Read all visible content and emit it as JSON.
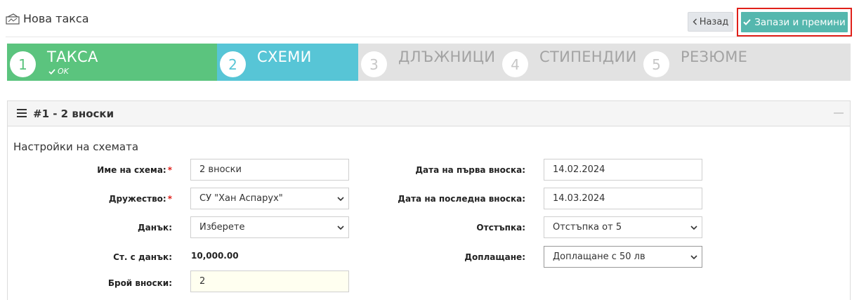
{
  "header": {
    "title": "Нова такса",
    "title_icon": "fee-ticket-icon",
    "back_label": "Назад",
    "save_label": "Запази и премини"
  },
  "steps": [
    {
      "number": "1",
      "label": "ТАКСА",
      "sub": "OK",
      "state": "done"
    },
    {
      "number": "2",
      "label": "СХЕМИ",
      "state": "active"
    },
    {
      "number": "3",
      "label": "ДЛЪЖНИЦИ",
      "state": "todo"
    },
    {
      "number": "4",
      "label": "СТИПЕНДИИ",
      "state": "todo"
    },
    {
      "number": "5",
      "label": "РЕЗЮМЕ",
      "state": "todo"
    }
  ],
  "panel": {
    "title": "#1 - 2 вноски",
    "section_title": "Настройки на схемата"
  },
  "form_left": {
    "scheme_name_label": "Име на схема:",
    "scheme_name_value": "2 вноски",
    "company_label": "Дружество:",
    "company_value": "СУ \"Хан Аспарух\"",
    "tax_label": "Данък:",
    "tax_value": "Изберете",
    "price_with_tax_label": "Ст. с данък:",
    "price_with_tax_value": "10,000.00",
    "installments_label": "Брой вноски:",
    "installments_value": "2"
  },
  "form_right": {
    "first_date_label": "Дата на първа вноска:",
    "first_date_value": "14.02.2024",
    "last_date_label": "Дата на последна вноска:",
    "last_date_value": "14.03.2024",
    "discount_label": "Отстъпка:",
    "discount_value": "Отстъпка от 5",
    "surcharge_label": "Доплащане:",
    "surcharge_value": "Доплащане с 50 лв"
  },
  "colors": {
    "done": "#5bc47e",
    "active": "#57c5d6",
    "save": "#55b7ae",
    "highlight": "#e0201a",
    "required": "#e0201a"
  }
}
